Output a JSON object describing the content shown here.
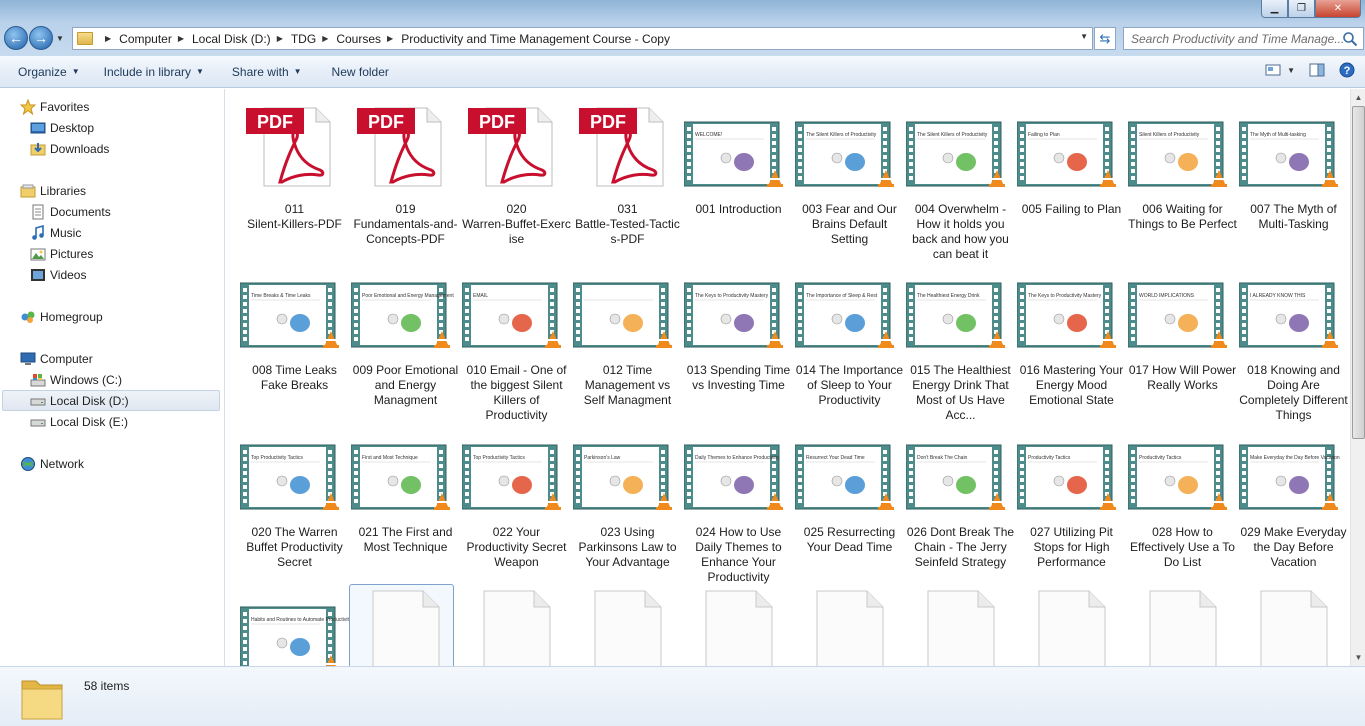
{
  "window": {
    "controls": [
      "minimize",
      "maximize",
      "close"
    ]
  },
  "address": {
    "crumbs": [
      "Computer",
      "Local Disk (D:)",
      "TDG",
      "Courses",
      "Productivity and Time Management Course - Copy"
    ],
    "search_placeholder": "Search Productivity and Time Manage..."
  },
  "toolbar": {
    "organize": "Organize",
    "include": "Include in library",
    "share": "Share with",
    "newfolder": "New folder"
  },
  "nav": {
    "favorites": "Favorites",
    "desktop": "Desktop",
    "downloads": "Downloads",
    "libraries": "Libraries",
    "documents": "Documents",
    "music": "Music",
    "pictures": "Pictures",
    "videos": "Videos",
    "homegroup": "Homegroup",
    "computer": "Computer",
    "windows_c": "Windows (C:)",
    "local_d": "Local Disk (D:)",
    "local_e": "Local Disk (E:)",
    "network": "Network"
  },
  "files": [
    {
      "kind": "pdf",
      "label": "011\nSilent-Killers-PDF"
    },
    {
      "kind": "pdf",
      "label": "019\nFundamentals-and-Concepts-PDF"
    },
    {
      "kind": "pdf",
      "label": "020\nWarren-Buffet-Exercise"
    },
    {
      "kind": "pdf",
      "label": "031\nBattle-Tested-Tactics-PDF"
    },
    {
      "kind": "video",
      "label": "001 Introduction",
      "slide": "WELCOME!"
    },
    {
      "kind": "video",
      "label": "003 Fear and Our Brains Default Setting",
      "slide": "The Silent Killers of Productivity"
    },
    {
      "kind": "video",
      "label": "004 Overwhelm - How it holds you back and how you can beat it",
      "slide": "The Silent Killers of Productivity"
    },
    {
      "kind": "video",
      "label": "005 Failing to Plan",
      "slide": "Failing to Plan"
    },
    {
      "kind": "video",
      "label": "006 Waiting for Things to Be Perfect",
      "slide": "Silent Killers of Productivity"
    },
    {
      "kind": "video",
      "label": "007 The Myth of Multi-Tasking",
      "slide": "The Myth of Multi-tasking"
    },
    {
      "kind": "video",
      "label": "008 Time Leaks Fake Breaks",
      "slide": "Time Breaks & Time Leaks"
    },
    {
      "kind": "video",
      "label": "009 Poor Emotional and Energy Managment",
      "slide": "Poor Emotional and Energy Management"
    },
    {
      "kind": "video",
      "label": "010 Email - One of the biggest Silent Killers of Productivity",
      "slide": "EMAIL"
    },
    {
      "kind": "video",
      "label": "012 Time Management vs Self Managment",
      "slide": ""
    },
    {
      "kind": "video",
      "label": "013 Spending Time vs Investing Time",
      "slide": "The Keys to Productivity Mastery"
    },
    {
      "kind": "video",
      "label": "014 The Importance of Sleep to Your Productivity",
      "slide": "The Importance of Sleep & Rest"
    },
    {
      "kind": "video",
      "label": "015 The Healthiest Energy Drink That Most of Us Have Acc...",
      "slide": "The Healthiest Energy Drink"
    },
    {
      "kind": "video",
      "label": "016 Mastering Your Energy Mood  Emotional State",
      "slide": "The Keys to Productivity Mastery"
    },
    {
      "kind": "video",
      "label": "017 How Will Power Really Works",
      "slide": "WORLD IMPLICATIONS"
    },
    {
      "kind": "video",
      "label": "018 Knowing and Doing Are Completely Different Things",
      "slide": "I ALREADY KNOW THIS"
    },
    {
      "kind": "video",
      "label": "020 The Warren Buffet Productivity Secret",
      "slide": "Top Productivity Tactics"
    },
    {
      "kind": "video",
      "label": "021 The First and Most Technique",
      "slide": "First and Most Technique"
    },
    {
      "kind": "video",
      "label": "022 Your Productivity Secret Weapon",
      "slide": "Top Productivity Tactics"
    },
    {
      "kind": "video",
      "label": "023 Using Parkinsons Law to Your Advantage",
      "slide": "Parkinson's Law"
    },
    {
      "kind": "video",
      "label": "024 How to Use Daily Themes to Enhance Your Productivity",
      "slide": "Daily Themes to Enhance Productivity"
    },
    {
      "kind": "video",
      "label": "025 Resurrecting Your Dead Time",
      "slide": "Resurrect Your Dead Time"
    },
    {
      "kind": "video",
      "label": "026 Dont Break The Chain - The Jerry Seinfeld Strategy",
      "slide": "Don't Break The Chain"
    },
    {
      "kind": "video",
      "label": "027 Utilizing Pit Stops for High Performance",
      "slide": "Productivity Tactics"
    },
    {
      "kind": "video",
      "label": "028 How to Effectively Use a To Do List",
      "slide": "Productivity Tactics"
    },
    {
      "kind": "video",
      "label": "029 Make Everyday the Day Before Vacation",
      "slide": "Make Everyday the Day Before Vacation"
    },
    {
      "kind": "video",
      "label": "",
      "slide": "Habits and Routines to Automate Productivity"
    },
    {
      "kind": "blank",
      "label": ""
    },
    {
      "kind": "blank",
      "label": ""
    },
    {
      "kind": "blank",
      "label": ""
    },
    {
      "kind": "blank",
      "label": ""
    },
    {
      "kind": "blank",
      "label": ""
    },
    {
      "kind": "blank",
      "label": ""
    },
    {
      "kind": "blank",
      "label": ""
    },
    {
      "kind": "blank",
      "label": ""
    },
    {
      "kind": "blank",
      "label": ""
    }
  ],
  "selected_index": 31,
  "status": {
    "count": "58 items"
  },
  "colors": {
    "accent": "#1e5fa8",
    "pdf_red": "#c8102e",
    "film_teal": "#4d8c8a"
  }
}
